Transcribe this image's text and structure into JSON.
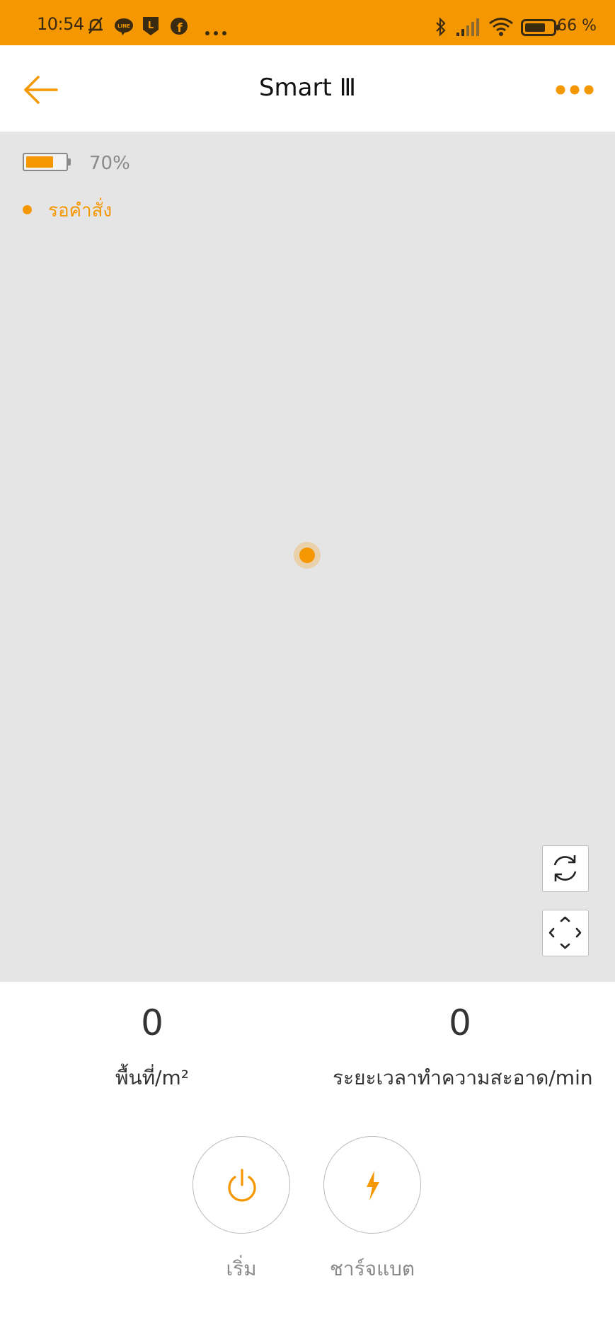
{
  "status_bar": {
    "time": "10:54",
    "battery_text": "66 %",
    "icons": [
      "muted-bell-icon",
      "line-app-icon",
      "l-app-icon",
      "facebook-icon",
      "more-dots-icon",
      "bluetooth-icon",
      "signal-icon",
      "wifi-icon",
      "battery-icon"
    ]
  },
  "header": {
    "title": "Smart Ⅲ"
  },
  "device": {
    "battery_percent": "70%",
    "battery_level": 0.7,
    "status": "รอคำสั่ง"
  },
  "stats": {
    "area_value": "0",
    "area_label": "พื้นที่/m²",
    "time_value": "0",
    "time_label": "ระยะเวลาทำความสะอาด/min"
  },
  "actions": {
    "start_label": "เริ่ม",
    "charge_label": "ชาร์จแบต"
  },
  "colors": {
    "accent": "#f59700",
    "map_background": "#e5e5e5",
    "text_primary": "#333333",
    "text_muted": "#8a8a8a"
  }
}
